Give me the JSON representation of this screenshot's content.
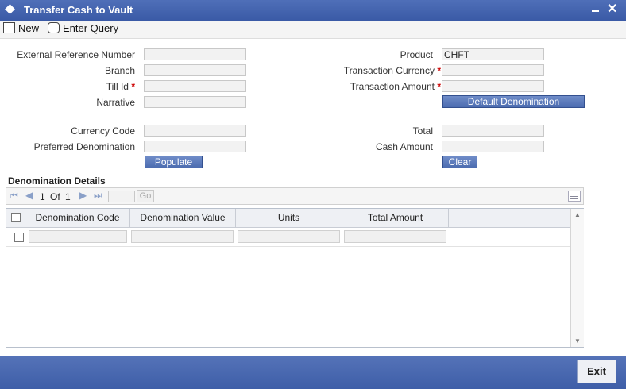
{
  "window": {
    "title": "Transfer Cash to Vault"
  },
  "toolbar": {
    "new_label": "New",
    "enter_query_label": "Enter Query"
  },
  "form": {
    "external_reference_number_label": "External Reference Number",
    "branch_label": "Branch",
    "till_id_label": "Till Id",
    "narrative_label": "Narrative",
    "product_label": "Product",
    "product_value": "CHFT",
    "transaction_currency_label": "Transaction Currency",
    "transaction_amount_label": "Transaction Amount",
    "default_denomination_button": "Default Denomination",
    "currency_code_label": "Currency Code",
    "preferred_denomination_label": "Preferred Denomination",
    "total_label": "Total",
    "cash_amount_label": "Cash Amount",
    "populate_button": "Populate",
    "clear_button": "Clear",
    "required_marker": "*"
  },
  "denomination": {
    "section_title": "Denomination Details",
    "pager": {
      "current": "1",
      "of_label": "Of",
      "total": "1",
      "go_label": "Go"
    },
    "columns": [
      "Denomination Code",
      "Denomination Value",
      "Units",
      "Total Amount"
    ]
  },
  "footer": {
    "exit_label": "Exit"
  },
  "colors": {
    "title_bar": "#3a5aa6",
    "button_blue": "#4c6cb0",
    "required": "#cc0000"
  }
}
